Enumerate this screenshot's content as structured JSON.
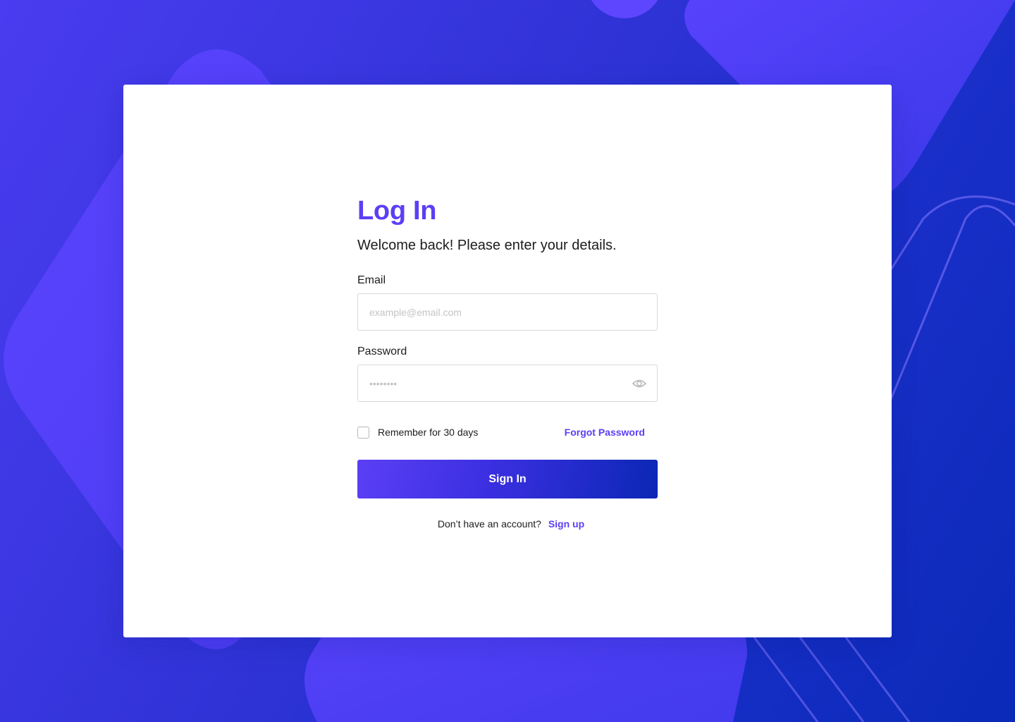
{
  "colors": {
    "accent": "#5b3ff5",
    "button_gradient_start": "#5b3ff5",
    "button_gradient_end": "#0b27b5",
    "background_start": "#4a3cf0",
    "background_end": "#0a2ab8",
    "card": "#ffffff",
    "text": "#1d1d1f",
    "input_border": "#d9d9de",
    "placeholder": "#c4c4c8"
  },
  "login": {
    "title": "Log In",
    "subtitle": "Welcome back! Please enter your details.",
    "email": {
      "label": "Email",
      "placeholder": "example@email.com",
      "value": ""
    },
    "password": {
      "label": "Password",
      "placeholder": "••••••••",
      "value": "",
      "toggle_icon": "eye-icon"
    },
    "remember": {
      "label": "Remember for 30 days",
      "checked": false
    },
    "forgot_label": "Forgot Password",
    "submit_label": "Sign In",
    "footer": {
      "prompt": "Don’t have an account?",
      "link": "Sign up"
    }
  }
}
